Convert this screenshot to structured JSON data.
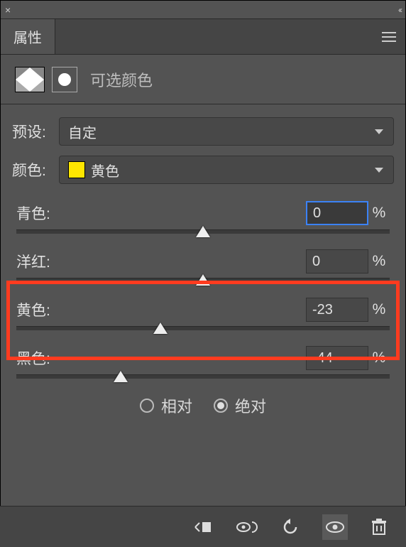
{
  "titlebar": {
    "close": "×",
    "collapse": "‹‹"
  },
  "tab": {
    "label": "属性"
  },
  "adjustment": {
    "title": "可选颜色"
  },
  "preset": {
    "label": "预设:",
    "value": "自定"
  },
  "color": {
    "label": "颜色:",
    "value": "黄色",
    "swatch": "#ffe600"
  },
  "sliders": {
    "cyan": {
      "label": "青色:",
      "value": "0",
      "pct": 50
    },
    "magenta": {
      "label": "洋红:",
      "value": "0",
      "pct": 50
    },
    "yellow": {
      "label": "黄色:",
      "value": "-23",
      "pct": 38.5
    },
    "black": {
      "label": "黑色:",
      "value": "-44",
      "pct": 28
    }
  },
  "percent_symbol": "%",
  "method": {
    "relative": "相对",
    "absolute": "绝对",
    "selected": "absolute"
  }
}
